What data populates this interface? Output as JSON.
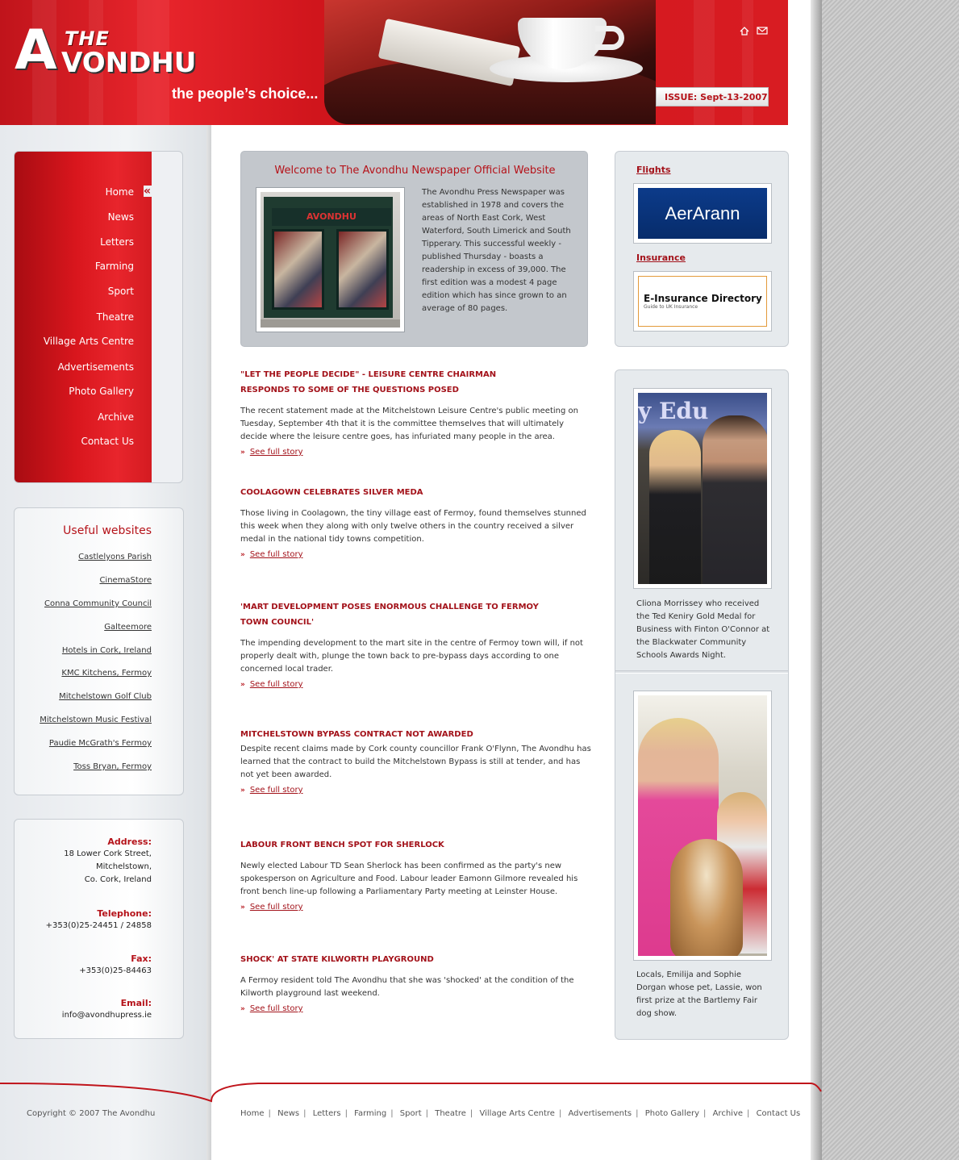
{
  "header": {
    "logo_the": "THE",
    "logo_a": "A",
    "logo_rest": "VONDHU",
    "tagline": "the people’s choice...",
    "issue": "ISSUE: Sept-13-2007",
    "icons": [
      "home-icon",
      "mail-icon"
    ]
  },
  "colors": {
    "brand_red": "#d81c22",
    "link_red": "#a3121a",
    "panel_grey": "#c3c7cc"
  },
  "nav": {
    "items": [
      {
        "label": "Home"
      },
      {
        "label": "News"
      },
      {
        "label": "Letters"
      },
      {
        "label": "Farming"
      },
      {
        "label": "Sport"
      },
      {
        "label": "Theatre"
      },
      {
        "label": "Village Arts Centre"
      },
      {
        "label": "Advertisements"
      },
      {
        "label": "Photo Gallery"
      },
      {
        "label": "Archive"
      },
      {
        "label": "Contact Us"
      }
    ],
    "active": "Home"
  },
  "useful": {
    "title": "Useful websites",
    "links": [
      "Castlelyons Parish",
      "CinemaStore",
      "Conna Community Council",
      "Galteemore",
      "Hotels in Cork, Ireland",
      "KMC Kitchens, Fermoy",
      "Mitchelstown Golf Club",
      "Mitchelstown Music Festival",
      "Paudie McGrath's Fermoy",
      "Toss Bryan, Fermoy"
    ]
  },
  "contact": {
    "address_label": "Address:",
    "address_lines": [
      "18 Lower Cork Street,",
      "Mitchelstown,",
      "Co. Cork, Ireland"
    ],
    "telephone_label": "Telephone:",
    "telephone": "+353(0)25-24451 / 24858",
    "fax_label": "Fax:",
    "fax": "+353(0)25-84463",
    "email_label": "Email:",
    "email": "info@avondhupress.ie"
  },
  "welcome": {
    "title": "Welcome to The Avondhu Newspaper Official Website",
    "shop_sign": "AVONDHU",
    "body": "The Avondhu Press Newspaper was established in 1978 and covers the areas of North East Cork, West Waterford, South Limerick and South Tipperary. This successful weekly - published Thursday - boasts a readership in excess of 39,000. The first edition was a modest 4 page edition which has since grown to an average of 80 pages."
  },
  "stories": [
    {
      "title": "\"LET THE PEOPLE DECIDE\" - LEISURE CENTRE CHAIRMAN RESPONDS TO SOME OF THE QUESTIONS POSED",
      "body": "The recent statement made at the Mitchelstown Leisure Centre's public meeting on Tuesday, September 4th that it is the committee themselves that will ultimately decide where the leisure centre goes, has infuriated many people in the area.",
      "more": "See full story"
    },
    {
      "title": "COOLAGOWN CELEBRATES SILVER MEDA",
      "body": "Those living in Coolagown, the tiny village east of Fermoy, found themselves stunned this week when they along with only twelve others in the country received a silver medal in the national tidy towns competition.",
      "more": "See full story"
    },
    {
      "title": "'MART DEVELOPMENT POSES ENORMOUS CHALLENGE TO FERMOY TOWN COUNCIL'",
      "body": "The impending development to the mart site in the centre of Fermoy town will, if not properly dealt with, plunge the town back to pre-bypass days according to one concerned local trader.",
      "more": "See full story"
    },
    {
      "title": "MITCHELSTOWN BYPASS CONTRACT NOT AWARDED",
      "body": "Despite recent claims made by Cork county councillor Frank O'Flynn, The Avondhu has learned that the contract to build the Mitchelstown Bypass is still at tender, and has not yet been awarded.",
      "more": "See full story"
    },
    {
      "title": "LABOUR FRONT BENCH SPOT FOR SHERLOCK",
      "body": "Newly elected Labour TD Sean Sherlock has been confirmed as the party's new spokesperson on Agriculture and Food. Labour leader Eamonn Gilmore revealed his front bench line-up following a Parliamentary Party meeting at Leinster House.",
      "more": "See full story"
    },
    {
      "title": "SHOCK' AT STATE KILWORTH PLAYGROUND",
      "body": "A Fermoy resident told The Avondhu that she was 'shocked' at the condition of the Kilworth playground last weekend.",
      "more": "See full story"
    }
  ],
  "ads": {
    "flights_label": "Flights",
    "flights_brand": "AerArann",
    "insurance_label": "Insurance",
    "insurance_brand": "E-Insurance Directory",
    "insurance_sub": "Guide to UK Insurance"
  },
  "photos": {
    "photo1_banner": "y Edu",
    "caption1": "Cliona Morrissey who received the Ted Keniry Gold Medal for Business with Finton O'Connor at the Blackwater Community Schools Awards Night.",
    "caption2": "Locals, Emilija and Sophie Dorgan whose pet, Lassie, won first prize at the Bartlemy Fair dog show."
  },
  "footer": {
    "copyright": "Copyright © 2007 The Avondhu",
    "links": [
      "Home",
      "News",
      "Letters",
      "Farming",
      "Sport",
      "Theatre",
      "Village Arts Centre",
      "Advertisements",
      "Photo Gallery",
      "Archive",
      "Contact Us"
    ]
  }
}
